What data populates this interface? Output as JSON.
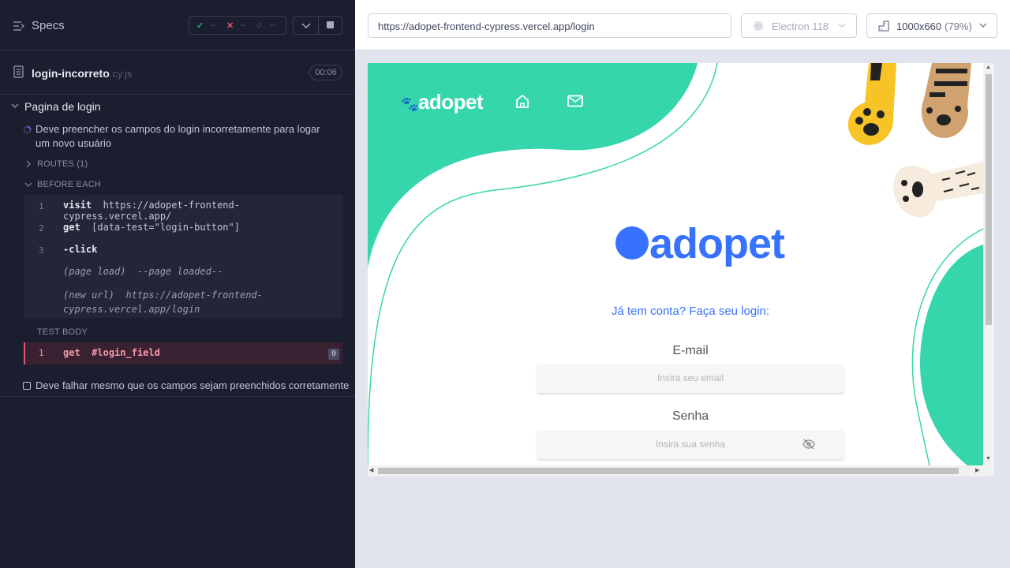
{
  "reporter": {
    "specs_label": "Specs",
    "stats": {
      "passed": "--",
      "failed": "--",
      "pending": "--"
    },
    "file": {
      "name": "login-incorreto",
      "ext": ".cy.js",
      "timer": "00:06"
    },
    "suite_title": "Pagina de login",
    "test_running": "Deve preencher os campos do login incorretamente para logar um novo usuário",
    "routes_label": "ROUTES (1)",
    "before_each_label": "BEFORE EACH",
    "before_each": [
      {
        "n": "1",
        "cmd": "visit",
        "arg": "https://adopet-frontend-cypress.vercel.app/"
      },
      {
        "n": "2",
        "cmd": "get",
        "arg": "[data-test=\"login-button\"]"
      },
      {
        "n": "3",
        "cmd": "-click",
        "arg": ""
      }
    ],
    "page_load_event": "(page load)",
    "page_load_msg": "--page loaded--",
    "new_url_event": "(new url)",
    "new_url_1": "https://adopet-frontend-",
    "new_url_2": "cypress.vercel.app/login",
    "test_body_label": "TEST BODY",
    "test_body": {
      "n": "1",
      "cmd": "get",
      "arg": "#login_field",
      "badge": "0"
    },
    "test_pending": "Deve falhar mesmo que os campos sejam preenchidos corretamente"
  },
  "runner": {
    "url": "https://adopet-frontend-cypress.vercel.app/login",
    "browser": "Electron 118",
    "viewport": "1000x660",
    "zoom": "(79%)"
  },
  "app": {
    "logo_small": "adopet",
    "logo_big": "adopet",
    "subtitle": "Já tem conta? Faça seu login:",
    "email_label": "E-mail",
    "email_placeholder": "Insira seu email",
    "password_label": "Senha",
    "password_placeholder": "Insira sua senha"
  },
  "colors": {
    "reporter_bg": "#1b1e2e",
    "accent_green": "#36d6ad",
    "brand_blue": "#3772ff",
    "fail_red": "#e45770"
  },
  "icons": [
    "menu-icon",
    "check-icon",
    "x-icon",
    "spinner-icon",
    "chevron-down-icon",
    "stop-icon",
    "file-icon",
    "home-icon",
    "mail-icon",
    "eye-off-icon",
    "electron-icon",
    "viewport-icon"
  ]
}
